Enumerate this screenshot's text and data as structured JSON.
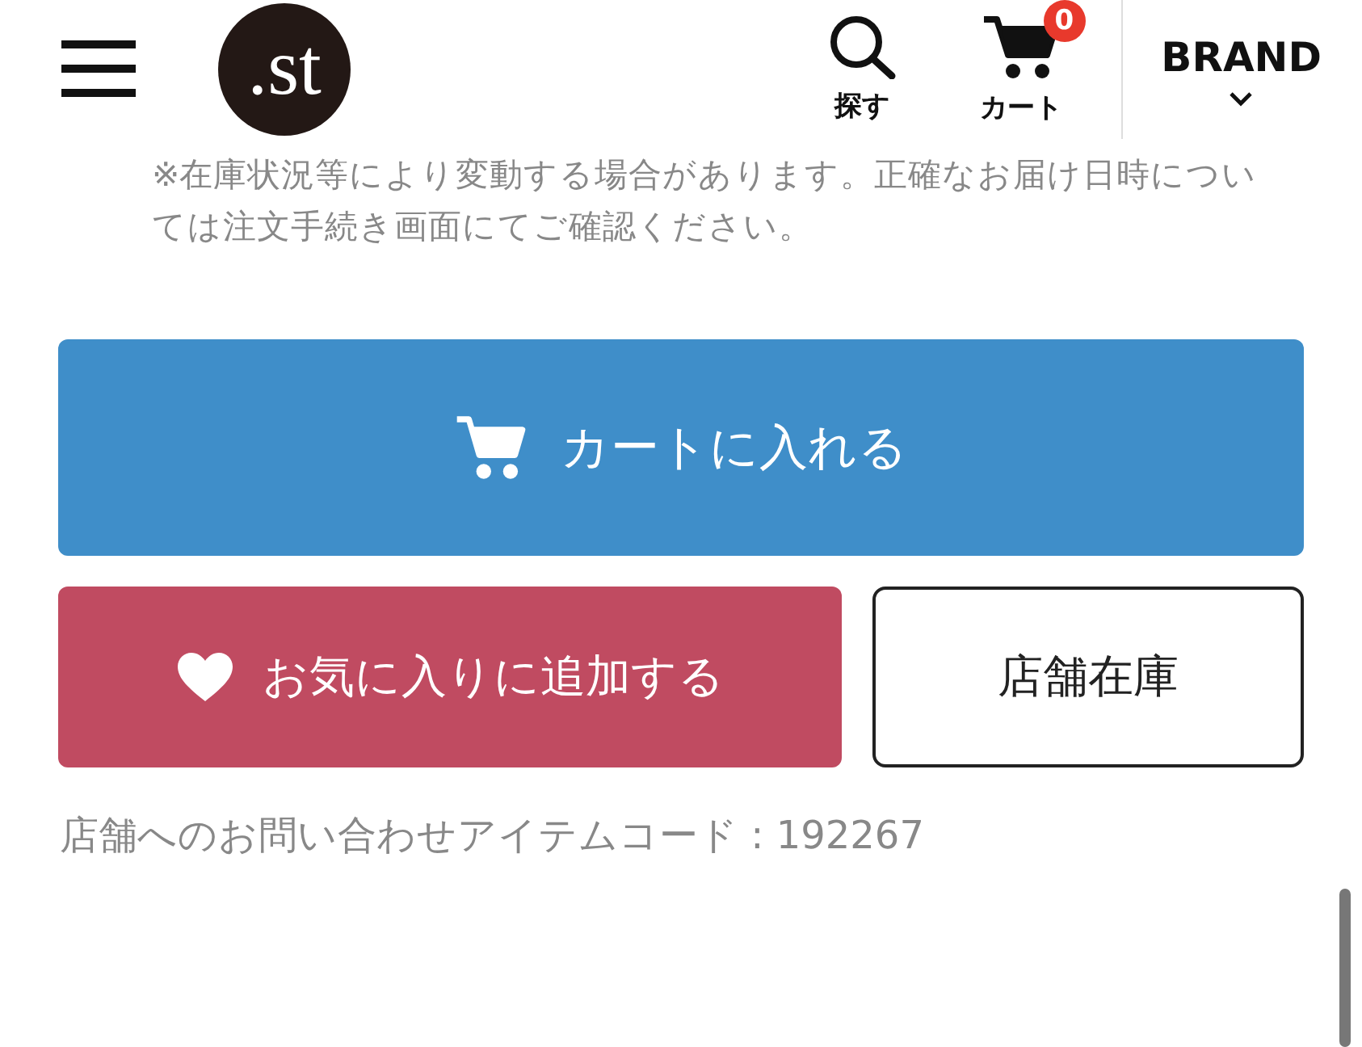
{
  "header": {
    "logo": ".st",
    "search_label": "探す",
    "cart_label": "カート",
    "cart_count": "0",
    "brand_label": "BRAND"
  },
  "notice": "※在庫状況等により変動する場合があります。正確なお届け日時については注文手続き画面にてご確認ください。",
  "buttons": [
    {
      "kind": "cart",
      "label": "カートに入れる"
    },
    {
      "kind": "favorite",
      "label": "お気に入りに追加する"
    },
    {
      "kind": "store",
      "label": "店舗在庫"
    }
  ],
  "item_code": "店舗へのお問い合わせアイテムコード : 192267"
}
